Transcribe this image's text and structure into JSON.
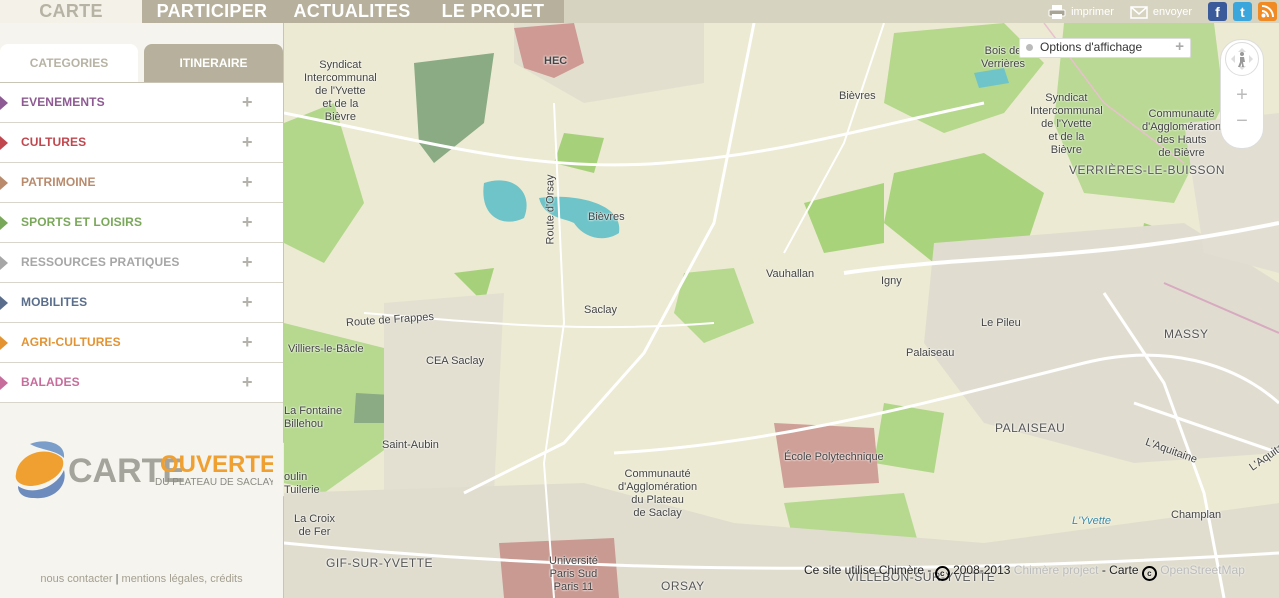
{
  "nav": {
    "tabs": [
      {
        "label": "CARTE"
      },
      {
        "label": "PARTICIPER"
      },
      {
        "label": "ACTUALITES"
      },
      {
        "label": "LE PROJET"
      }
    ],
    "tools": {
      "print": "imprimer",
      "send": "envoyer"
    },
    "social": [
      "facebook-icon",
      "twitter-icon",
      "rss-icon"
    ]
  },
  "sidebar": {
    "tabs": [
      {
        "label": "CATEGORIES"
      },
      {
        "label": "ITINERAIRE"
      }
    ],
    "categories": [
      {
        "label": "EVENEMENTS",
        "color": "#8e5a93"
      },
      {
        "label": "CULTURES",
        "color": "#c1474e"
      },
      {
        "label": "PATRIMOINE",
        "color": "#b98a6c"
      },
      {
        "label": "SPORTS ET LOISIRS",
        "color": "#7aa85a"
      },
      {
        "label": "RESSOURCES PRATIQUES",
        "color": "#a6a6a6"
      },
      {
        "label": "MOBILITES",
        "color": "#5a6e8c"
      },
      {
        "label": "AGRI-CULTURES",
        "color": "#e39332"
      },
      {
        "label": "BALADES",
        "color": "#c76d9b"
      }
    ],
    "logo": {
      "word1": "CARTE",
      "word2": "OUVERTE",
      "sub": "DU PLATEAU DE SACLAY"
    },
    "footer": {
      "contact": "nous contacter",
      "legal": "mentions légales, crédits"
    }
  },
  "map": {
    "options_label": "Options d'affichage",
    "zoom": {
      "in": "+",
      "out": "−"
    },
    "places": {
      "hec": "HEC",
      "syndicat_left": "Syndicat\nIntercommunal\nde l'Yvette\net de la\nBièvre",
      "bois_verrieres": "Bois de\nVerrières",
      "syndicat_right": "Syndicat\nIntercommunal\nde l'Yvette\net de la\nBièvre",
      "communaute_hauts": "Communauté\nd'Agglomération\ndes Hauts\nde Bièvre",
      "verrieres": "VERRIÈRES-LE-BUISSON",
      "bievres_top": "Bièvres",
      "route_orsay": "Route d'Orsay",
      "bievres": "Bièvres",
      "vauhallan": "Vauhallan",
      "igny": "Igny",
      "saclay": "Saclay",
      "route_frappes": "Route de Frappes",
      "villiers": "Villiers-le-Bâcle",
      "cea": "CEA Saclay",
      "lepileu": "Le Pileu",
      "massy": "MASSY",
      "palaiseau_small": "Palaiseau",
      "lafontaine": "La Fontaine\nBillehou",
      "saint_aubin": "Saint-Aubin",
      "palaiseau": "PALAISEAU",
      "aquitaine1": "L'Aquitaine",
      "aquitaine2": "L'Aquitaine",
      "polytechnique": "École Polytechnique",
      "communaute_plateau": "Communauté\nd'Agglomération\ndu Plateau\nde Saclay",
      "moulin": "oulin\nTuilerie",
      "lacroix": "La Croix\nde Fer",
      "champlan": "Champlan",
      "yvette": "L'Yvette",
      "gif": "GIF-SUR-YVETTE",
      "universite": "Université\nParis Sud\nParis 11",
      "orsay": "ORSAY",
      "villebon": "VILLEBON-SUR-YVETTE"
    },
    "attribution": {
      "pre": "Ce site utilise Chimère - ",
      "years": "2008-2013",
      "project": "Chimère project",
      "mid": " - Carte ",
      "osm": "OpenStreetMap"
    }
  }
}
